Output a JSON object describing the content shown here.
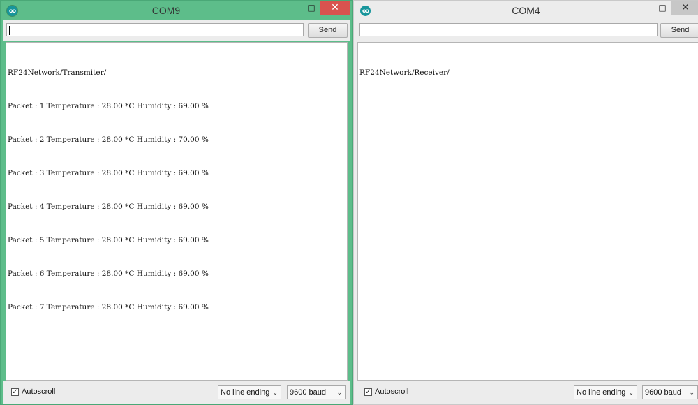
{
  "windows": [
    {
      "title": "COM9",
      "input_value": "",
      "send_label": "Send",
      "output_lines": [
        "RF24Network/Transmiter/",
        "Packet : 1 Temperature : 28.00 *C Humidity : 69.00 %",
        "Packet : 2 Temperature : 28.00 *C Humidity : 70.00 %",
        "Packet : 3 Temperature : 28.00 *C Humidity : 69.00 %",
        "Packet : 4 Temperature : 28.00 *C Humidity : 69.00 %",
        "Packet : 5 Temperature : 28.00 *C Humidity : 69.00 %",
        "Packet : 6 Temperature : 28.00 *C Humidity : 69.00 %",
        "Packet : 7 Temperature : 28.00 *C Humidity : 69.00 %"
      ],
      "autoscroll_label": "Autoscroll",
      "autoscroll_checked": true,
      "line_ending": "No line ending",
      "baud": "9600 baud",
      "active": true
    },
    {
      "title": "COM4",
      "input_value": "",
      "send_label": "Send",
      "output_lines": [
        "RF24Network/Receiver/"
      ],
      "autoscroll_label": "Autoscroll",
      "autoscroll_checked": true,
      "line_ending": "No line ending",
      "baud": "9600 baud",
      "active": false
    }
  ],
  "icons": {
    "app": "arduino-icon",
    "minimize": "minimize-icon",
    "maximize": "maximize-icon",
    "close": "close-icon",
    "checkbox": "checkbox-checked-icon",
    "dropdown": "chevron-down-icon"
  },
  "colors": {
    "active_frame": "#5dbd8a",
    "inactive_frame": "#ececec",
    "close_active": "#d9534f",
    "app_icon": "#17959b"
  }
}
